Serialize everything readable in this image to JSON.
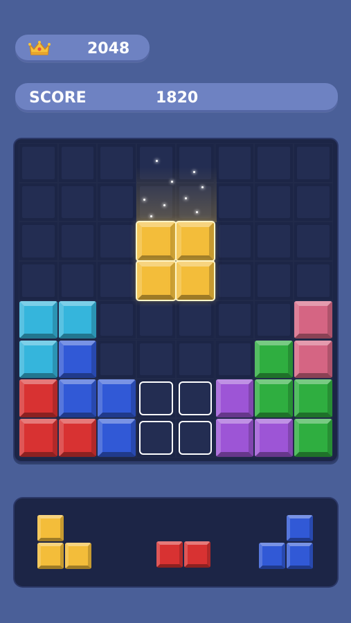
{
  "best_score": {
    "icon": "crown-icon",
    "value": "2048"
  },
  "score": {
    "label": "SCORE",
    "value": "1820"
  },
  "colors": {
    "yellow": "#f3bd3a",
    "cyan": "#35b5dc",
    "blue": "#3159d6",
    "red": "#d83232",
    "purple": "#9d55d6",
    "green": "#2fae40",
    "pink": "#d56583"
  },
  "board": {
    "cols": 8,
    "rows": 8,
    "blocks": [
      {
        "row": 2,
        "col": 3,
        "color": "yellow",
        "highlight": true
      },
      {
        "row": 2,
        "col": 4,
        "color": "yellow",
        "highlight": true
      },
      {
        "row": 3,
        "col": 3,
        "color": "yellow",
        "highlight": true
      },
      {
        "row": 3,
        "col": 4,
        "color": "yellow",
        "highlight": true
      },
      {
        "row": 4,
        "col": 0,
        "color": "cyan"
      },
      {
        "row": 4,
        "col": 1,
        "color": "cyan"
      },
      {
        "row": 4,
        "col": 7,
        "color": "pink"
      },
      {
        "row": 5,
        "col": 0,
        "color": "cyan"
      },
      {
        "row": 5,
        "col": 1,
        "color": "blue"
      },
      {
        "row": 5,
        "col": 6,
        "color": "green"
      },
      {
        "row": 5,
        "col": 7,
        "color": "pink"
      },
      {
        "row": 6,
        "col": 0,
        "color": "red"
      },
      {
        "row": 6,
        "col": 1,
        "color": "blue"
      },
      {
        "row": 6,
        "col": 2,
        "color": "blue"
      },
      {
        "row": 6,
        "col": 5,
        "color": "purple"
      },
      {
        "row": 6,
        "col": 6,
        "color": "green"
      },
      {
        "row": 6,
        "col": 7,
        "color": "green"
      },
      {
        "row": 7,
        "col": 0,
        "color": "red"
      },
      {
        "row": 7,
        "col": 1,
        "color": "red"
      },
      {
        "row": 7,
        "col": 2,
        "color": "blue"
      },
      {
        "row": 7,
        "col": 5,
        "color": "purple"
      },
      {
        "row": 7,
        "col": 6,
        "color": "purple"
      },
      {
        "row": 7,
        "col": 7,
        "color": "green"
      }
    ],
    "placement_preview": [
      {
        "row": 6,
        "col": 3
      },
      {
        "row": 6,
        "col": 4
      },
      {
        "row": 7,
        "col": 3
      },
      {
        "row": 7,
        "col": 4
      }
    ]
  },
  "tray": {
    "pieces": [
      {
        "name": "piece-yellow-l",
        "color": "yellow",
        "cells": [
          [
            0,
            0
          ],
          [
            1,
            0
          ],
          [
            1,
            1
          ]
        ]
      },
      {
        "name": "piece-red-bar",
        "color": "red",
        "cells": [
          [
            0,
            0
          ],
          [
            0,
            1
          ]
        ]
      },
      {
        "name": "piece-blue-j",
        "color": "blue",
        "cells": [
          [
            0,
            1
          ],
          [
            1,
            0
          ],
          [
            1,
            1
          ]
        ]
      }
    ]
  }
}
